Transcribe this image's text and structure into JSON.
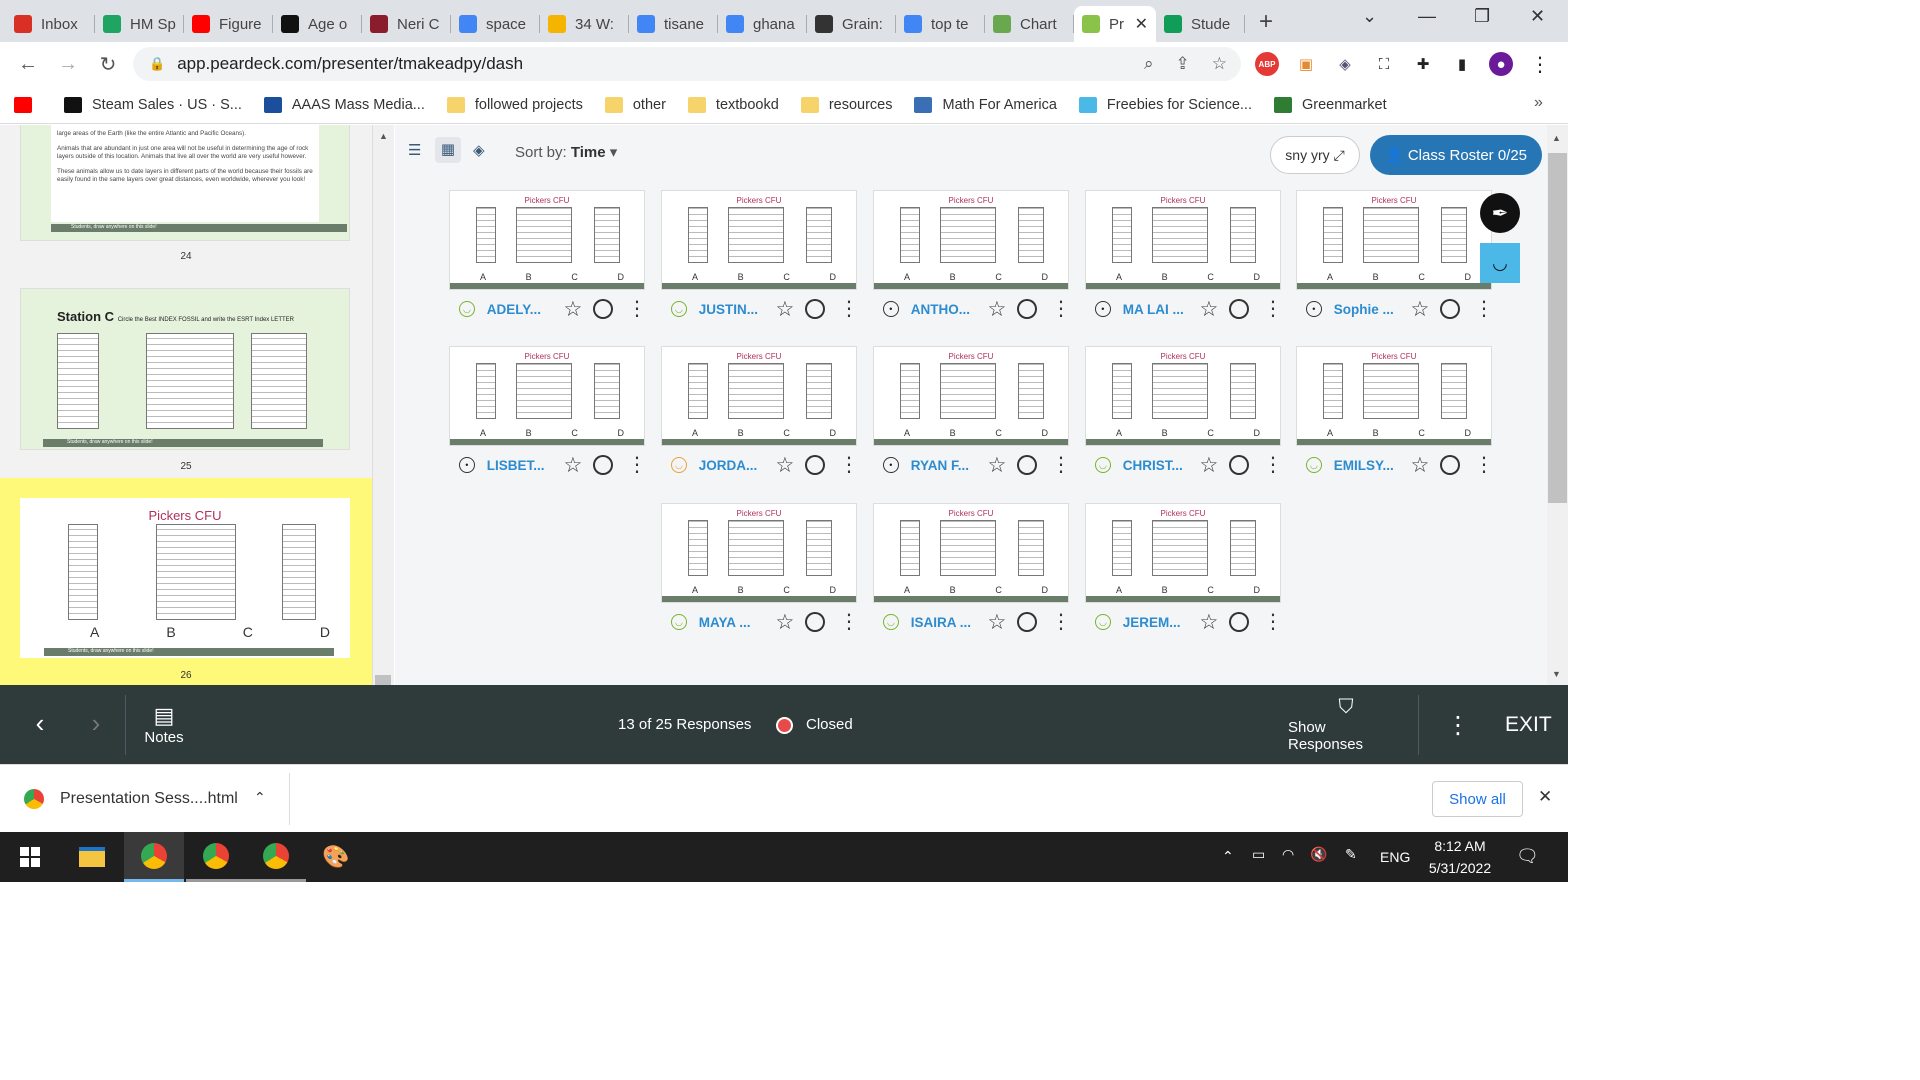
{
  "browser": {
    "tabs": [
      {
        "label": "Inbox",
        "icon": "gmail-icon",
        "color": "#d93025"
      },
      {
        "label": "HM Sp",
        "icon": "drive-icon",
        "color": "#1fa463"
      },
      {
        "label": "Figure",
        "icon": "youtube-icon",
        "color": "#ff0000"
      },
      {
        "label": "Age o",
        "icon": "j-icon",
        "color": "#111111"
      },
      {
        "label": "Neri C",
        "icon": "bars-icon",
        "color": "#8b1c2b"
      },
      {
        "label": "space",
        "icon": "google-icon",
        "color": "#4285f4"
      },
      {
        "label": "34 W:",
        "icon": "slides-icon",
        "color": "#f4b400"
      },
      {
        "label": "tisane",
        "icon": "google-icon",
        "color": "#4285f4"
      },
      {
        "label": "ghana",
        "icon": "google-icon",
        "color": "#4285f4"
      },
      {
        "label": "Grain:",
        "icon": "wikipedia-icon",
        "color": "#333333"
      },
      {
        "label": "top te",
        "icon": "google-icon",
        "color": "#4285f4"
      },
      {
        "label": "Chart",
        "icon": "chart-icon",
        "color": "#6aa84f"
      },
      {
        "label": "Pr",
        "icon": "peardeck-icon",
        "color": "#8bc34a",
        "active": true
      },
      {
        "label": "Stude",
        "icon": "classroom-icon",
        "color": "#0f9d58"
      }
    ],
    "url": "app.peardeck.com/presenter/tmakeadpy/dash"
  },
  "bookmarks": [
    {
      "label": "",
      "icon": "youtube-icon"
    },
    {
      "label": "Steam Sales · US · S...",
      "icon": "steam-icon"
    },
    {
      "label": "AAAS Mass Media...",
      "icon": "aaas-icon"
    },
    {
      "label": "followed projects",
      "icon": "folder-icon"
    },
    {
      "label": "other",
      "icon": "folder-icon"
    },
    {
      "label": "textbookd",
      "icon": "folder-icon"
    },
    {
      "label": "resources",
      "icon": "folder-icon"
    },
    {
      "label": "Math For America",
      "icon": "mfa-icon"
    },
    {
      "label": "Freebies for Science...",
      "icon": "leaf-icon"
    },
    {
      "label": "Greenmarket",
      "icon": "greenmarket-icon"
    }
  ],
  "sidebar": {
    "slides": [
      {
        "num": "24",
        "text": [
          "large areas of the Earth (like the entire Atlantic and Pacific Oceans).",
          "Animals that are abundant in just one area will not be useful in determining the age of rock layers outside of this location. Animals that live all over the world are very useful however.",
          "These animals allow us to date layers in different parts of the world because their fossils are easily found in the same layers over great distances, even worldwide, wherever you look!"
        ]
      },
      {
        "num": "25",
        "title": "Station C",
        "subtitle": "Circle the Best INDEX FOSSIL and write the ESRT Index LETTER"
      },
      {
        "num": "26",
        "title": "Pickers CFU",
        "selected": true
      }
    ],
    "footer": "Students, draw anywhere on this slide!"
  },
  "toolbar": {
    "sort_label": "Sort by:",
    "sort_value": "Time",
    "code": "sny yry",
    "roster": "Class Roster 0/25"
  },
  "slide_title": "Pickers CFU",
  "letters": [
    "A",
    "B",
    "C",
    "D"
  ],
  "responses": [
    {
      "name": "ADELY...",
      "face": "smile"
    },
    {
      "name": "JUSTIN...",
      "face": "smile"
    },
    {
      "name": "ANTHO...",
      "face": "neutral"
    },
    {
      "name": "MA LAI ...",
      "face": "neutral"
    },
    {
      "name": "Sophie ...",
      "face": "neutral"
    },
    {
      "name": "LISBET...",
      "face": "neutral"
    },
    {
      "name": "JORDA...",
      "face": "orange"
    },
    {
      "name": "RYAN F...",
      "face": "neutral"
    },
    {
      "name": "CHRIST...",
      "face": "smile"
    },
    {
      "name": "EMILSY...",
      "face": "smile"
    },
    {
      "name": "MAYA ...",
      "face": "smile"
    },
    {
      "name": "ISAIRA ...",
      "face": "smile"
    },
    {
      "name": "JEREM...",
      "face": "smile"
    }
  ],
  "bottom": {
    "notes": "Notes",
    "responses": "13 of 25 Responses",
    "status": "Closed",
    "show": "Show Responses",
    "exit": "EXIT"
  },
  "download": {
    "file": "Presentation Sess....html",
    "show_all": "Show all"
  },
  "taskbar": {
    "lang": "ENG",
    "time": "8:12 AM",
    "date": "5/31/2022"
  }
}
